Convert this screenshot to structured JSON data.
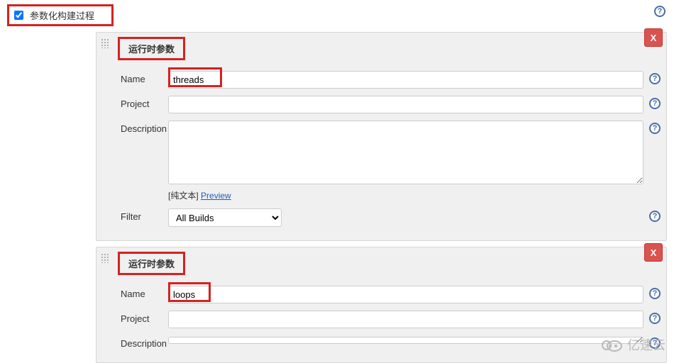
{
  "top": {
    "checkbox_label": "参数化构建过程",
    "checkbox_checked": true
  },
  "params": [
    {
      "title": "运行时参数",
      "name_label": "Name",
      "name_value": "threads",
      "project_label": "Project",
      "project_value": "",
      "description_label": "Description",
      "description_value": "",
      "plain_text": "[纯文本]",
      "preview_link": "Preview",
      "filter_label": "Filter",
      "filter_value": "All Builds"
    },
    {
      "title": "运行时参数",
      "name_label": "Name",
      "name_value": "loops",
      "project_label": "Project",
      "project_value": "",
      "description_label": "Description",
      "description_value": ""
    }
  ],
  "filter_options": [
    "All Builds"
  ],
  "icons": {
    "help": "?",
    "delete": "X"
  },
  "watermark": "亿速云"
}
